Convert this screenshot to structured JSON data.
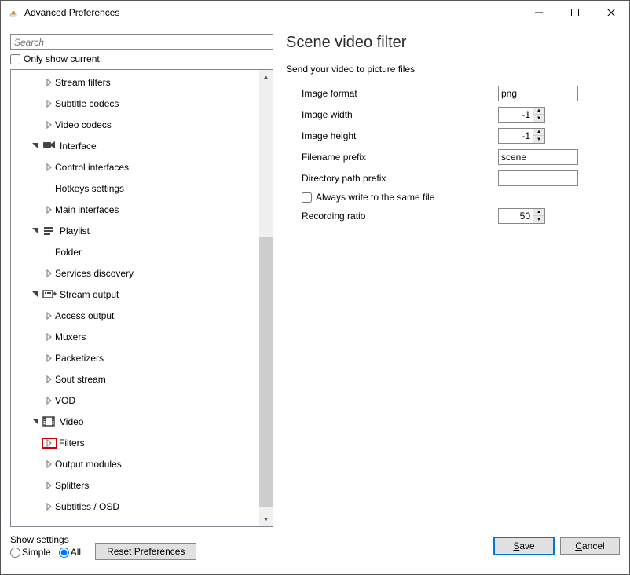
{
  "window": {
    "title": "Advanced Preferences"
  },
  "search": {
    "placeholder": "Search"
  },
  "left": {
    "only_current": "Only show current",
    "tree": {
      "items": [
        {
          "label": "Stream filters",
          "indent": 2,
          "expander": ">",
          "icon": null
        },
        {
          "label": "Subtitle codecs",
          "indent": 2,
          "expander": ">",
          "icon": null
        },
        {
          "label": "Video codecs",
          "indent": 2,
          "expander": ">",
          "icon": null
        },
        {
          "label": "Interface",
          "indent": 1,
          "expander": "v",
          "icon": "interface"
        },
        {
          "label": "Control interfaces",
          "indent": 2,
          "expander": ">",
          "icon": null
        },
        {
          "label": "Hotkeys settings",
          "indent": 2,
          "expander": "",
          "icon": null
        },
        {
          "label": "Main interfaces",
          "indent": 2,
          "expander": ">",
          "icon": null
        },
        {
          "label": "Playlist",
          "indent": 1,
          "expander": "v",
          "icon": "playlist"
        },
        {
          "label": "Folder",
          "indent": 2,
          "expander": "",
          "icon": null
        },
        {
          "label": "Services discovery",
          "indent": 2,
          "expander": ">",
          "icon": null
        },
        {
          "label": "Stream output",
          "indent": 1,
          "expander": "v",
          "icon": "stream"
        },
        {
          "label": "Access output",
          "indent": 2,
          "expander": ">",
          "icon": null
        },
        {
          "label": "Muxers",
          "indent": 2,
          "expander": ">",
          "icon": null
        },
        {
          "label": "Packetizers",
          "indent": 2,
          "expander": ">",
          "icon": null
        },
        {
          "label": "Sout stream",
          "indent": 2,
          "expander": ">",
          "icon": null
        },
        {
          "label": "VOD",
          "indent": 2,
          "expander": ">",
          "icon": null
        },
        {
          "label": "Video",
          "indent": 1,
          "expander": "v",
          "icon": "video"
        },
        {
          "label": "Filters",
          "indent": 2,
          "expander": ">",
          "icon": null,
          "highlight": true
        },
        {
          "label": "Output modules",
          "indent": 2,
          "expander": ">",
          "icon": null
        },
        {
          "label": "Splitters",
          "indent": 2,
          "expander": ">",
          "icon": null
        },
        {
          "label": "Subtitles / OSD",
          "indent": 2,
          "expander": ">",
          "icon": null
        }
      ]
    }
  },
  "right": {
    "title": "Scene video filter",
    "subtitle": "Send your video to picture files",
    "labels": {
      "image_format": "Image format",
      "image_width": "Image width",
      "image_height": "Image height",
      "filename_prefix": "Filename prefix",
      "dir_prefix": "Directory path prefix",
      "always_write": "Always write to the same file",
      "recording_ratio": "Recording ratio"
    },
    "values": {
      "image_format": "png",
      "image_width": "-1",
      "image_height": "-1",
      "filename_prefix": "scene",
      "dir_prefix": "",
      "recording_ratio": "50"
    }
  },
  "bottom": {
    "show_settings": "Show settings",
    "simple": "Simple",
    "all": "All",
    "reset": "Reset Preferences",
    "save": "Save",
    "cancel": "Cancel"
  }
}
